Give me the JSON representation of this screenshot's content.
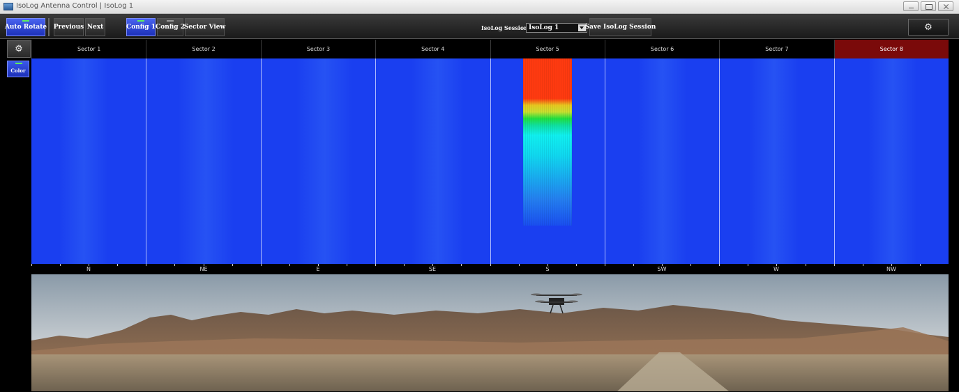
{
  "window": {
    "title": "IsoLog Antenna Control | IsoLog 1"
  },
  "toolbar": {
    "auto_rotate_label": "Auto Rotate",
    "previous_label": "Previous",
    "next_label": "Next",
    "config1_label": "Config 1",
    "config2_label": "Config 2",
    "sector_view_label": "Sector View",
    "session_label": "IsoLog Session:",
    "session_value": "IsoLog 1",
    "save_session_label": "Save IsoLog Session"
  },
  "sectors": [
    {
      "label": "Sector 1",
      "selected": false
    },
    {
      "label": "Sector 2",
      "selected": false
    },
    {
      "label": "Sector 3",
      "selected": false
    },
    {
      "label": "Sector 4",
      "selected": false
    },
    {
      "label": "Sector 5",
      "selected": false
    },
    {
      "label": "Sector 6",
      "selected": false
    },
    {
      "label": "Sector 7",
      "selected": false
    },
    {
      "label": "Sector 8",
      "selected": true
    }
  ],
  "side": {
    "color_label": "Color"
  },
  "compass": [
    "N",
    "NE",
    "E",
    "SE",
    "S",
    "SW",
    "W",
    "NW"
  ],
  "colors": {
    "accent_blue": "#1c30b8",
    "selected_sector": "#7a0a0a",
    "waterfall_base": "#1a3ff0",
    "signal_hot": "#ff3a10"
  },
  "icons": {
    "settings": "gear-icon",
    "side_settings": "gear-icon",
    "dropdown": "chevron-down-icon"
  }
}
